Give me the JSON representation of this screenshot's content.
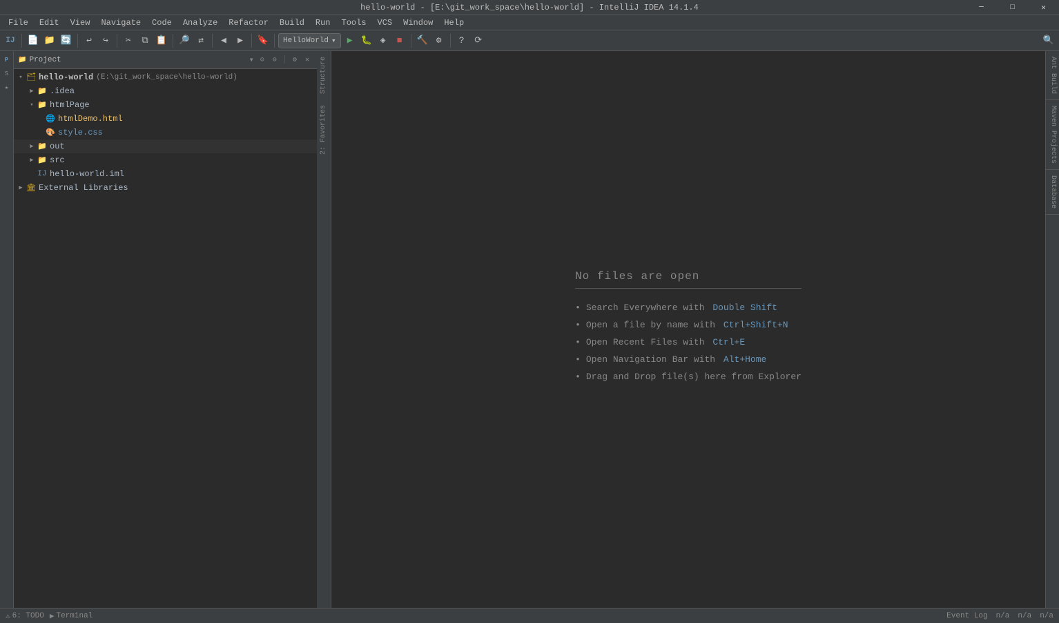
{
  "window": {
    "title": "hello-world - [E:\\git_work_space\\hello-world] - IntelliJ IDEA 14.1.4",
    "minimize_label": "─",
    "maximize_label": "□",
    "close_label": "✕"
  },
  "menu": {
    "items": [
      "File",
      "Edit",
      "View",
      "Navigate",
      "Code",
      "Analyze",
      "Refactor",
      "Build",
      "Run",
      "Tools",
      "VCS",
      "Window",
      "Help"
    ]
  },
  "toolbar": {
    "run_config": "HelloWorld",
    "search_icon": "🔍"
  },
  "project_panel": {
    "title": "Project",
    "dropdown_arrow": "▾",
    "root": {
      "name": "hello-world",
      "path": "(E:\\git_work_space\\hello-world)",
      "children": [
        {
          "name": ".idea",
          "type": "folder",
          "expanded": false
        },
        {
          "name": "htmlPage",
          "type": "folder",
          "expanded": true,
          "children": [
            {
              "name": "htmlDemo.html",
              "type": "html"
            },
            {
              "name": "style.css",
              "type": "css"
            }
          ]
        },
        {
          "name": "out",
          "type": "folder",
          "expanded": false
        },
        {
          "name": "src",
          "type": "folder",
          "expanded": false
        },
        {
          "name": "hello-world.iml",
          "type": "iml"
        }
      ]
    },
    "external_libraries": "External Libraries"
  },
  "editor": {
    "no_files_title": "No files are open",
    "hints": [
      {
        "text": "Search Everywhere with ",
        "shortcut": "Double Shift",
        "shortcut_color": "#6897bb"
      },
      {
        "text": "Open a file by name with ",
        "shortcut": "Ctrl+Shift+N",
        "shortcut_color": "#6897bb"
      },
      {
        "text": "Open Recent Files with ",
        "shortcut": "Ctrl+E",
        "shortcut_color": "#6897bb"
      },
      {
        "text": "Open Navigation Bar with ",
        "shortcut": "Alt+Home",
        "shortcut_color": "#6897bb"
      },
      {
        "text": "Drag and Drop file(s) here from Explorer",
        "shortcut": "",
        "shortcut_color": ""
      }
    ]
  },
  "side_tabs": {
    "left": [
      "Structure",
      "2: Favorites"
    ],
    "right": [
      "Ant Build",
      "Maven Projects",
      "Database"
    ]
  },
  "status_bar": {
    "todo_icon": "⚠",
    "todo_label": "6: TODO",
    "terminal_icon": "▶",
    "terminal_label": "Terminal",
    "event_log": "Event Log",
    "position": "n/a",
    "position2": "n/a",
    "encoding": "n/a"
  }
}
